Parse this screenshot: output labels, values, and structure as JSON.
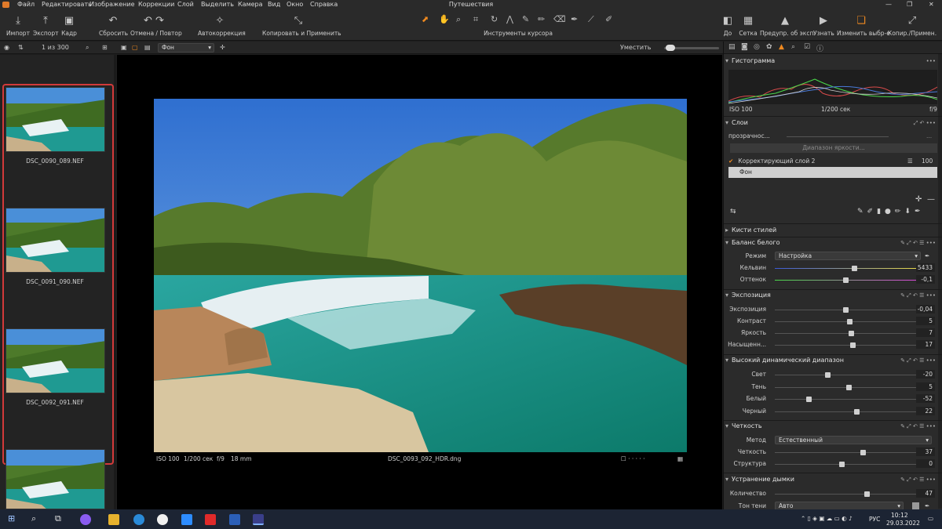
{
  "app": {
    "window_title": "Путешествия"
  },
  "menu": [
    "Файл",
    "Редактировать",
    "Изображение",
    "Коррекции",
    "Слой",
    "Выделить",
    "Камера",
    "Вид",
    "Окно",
    "Справка"
  ],
  "toolbar": {
    "import": "Импорт",
    "export": "Экспорт",
    "crop": "Кадр",
    "reset": "Сбросить",
    "undo_redo": "Отмена / Повтор",
    "autocorrect": "Автокоррекция",
    "copy_apply": "Копировать и Применить",
    "cursor_tools": "Инструменты курсора",
    "before": "До",
    "grid": "Сетка",
    "exposure_warn": "Предупр. об эксп.",
    "learn": "Узнать",
    "edit_selected": "Изменить выбр-е",
    "copy_apply2": "Копир./Примен."
  },
  "browser": {
    "counter": "1 из 300",
    "thumbs": [
      {
        "name": "DSC_0090_089.NEF"
      },
      {
        "name": "DSC_0091_090.NEF"
      },
      {
        "name": "DSC_0092_091.NEF"
      },
      {
        "name": ""
      }
    ]
  },
  "viewer": {
    "layer_select": "Фон",
    "fit": "Уместить",
    "iso": "ISO 100",
    "shutter": "1/200 сек",
    "aperture": "f/9",
    "focal": "18 mm",
    "filename": "DSC_0093_092_HDR.dng"
  },
  "panel": {
    "histogram": {
      "title": "Гистограмма",
      "iso": "ISO 100",
      "shutter": "1/200 сек",
      "aperture": "f/9"
    },
    "layers": {
      "title": "Слои",
      "opacity_label": "прозрачнос...",
      "luma_range": "Диапазон яркости...",
      "items": [
        {
          "name": "Корректирующий слой 2",
          "value": "100 %"
        },
        {
          "name": "Фон"
        }
      ]
    },
    "style_brushes": {
      "title": "Кисти стилей"
    },
    "white_balance": {
      "title": "Баланс белого",
      "mode_label": "Режим",
      "mode_value": "Настройка",
      "rows": [
        {
          "label": "Кельвин",
          "value": "5433",
          "pos": 0.56
        },
        {
          "label": "Оттенок",
          "value": "-0,1",
          "pos": 0.5
        }
      ]
    },
    "exposure": {
      "title": "Экспозиция",
      "rows": [
        {
          "label": "Экспозиция",
          "value": "-0,04",
          "pos": 0.5
        },
        {
          "label": "Контраст",
          "value": "5",
          "pos": 0.53
        },
        {
          "label": "Яркость",
          "value": "7",
          "pos": 0.54
        },
        {
          "label": "Насыщенн...",
          "value": "17",
          "pos": 0.55
        }
      ]
    },
    "hdr": {
      "title": "Высокий динамический диапазон",
      "rows": [
        {
          "label": "Свет",
          "value": "-20",
          "pos": 0.37
        },
        {
          "label": "Тень",
          "value": "5",
          "pos": 0.52
        },
        {
          "label": "Белый",
          "value": "-52",
          "pos": 0.24
        },
        {
          "label": "Черный",
          "value": "22",
          "pos": 0.58
        }
      ]
    },
    "clarity": {
      "title": "Четкость",
      "method_label": "Метод",
      "method_value": "Естественный",
      "rows": [
        {
          "label": "Четкость",
          "value": "37",
          "pos": 0.62
        },
        {
          "label": "Структура",
          "value": "0",
          "pos": 0.47
        }
      ]
    },
    "dehaze": {
      "title": "Устранение дымки",
      "rows": [
        {
          "label": "Количество",
          "value": "47",
          "pos": 0.65
        }
      ],
      "tone_label": "Тон тени",
      "tone_value": "Авто"
    }
  },
  "taskbar": {
    "lang": "РУС",
    "time": "10:12",
    "date": "29.03.2022"
  }
}
